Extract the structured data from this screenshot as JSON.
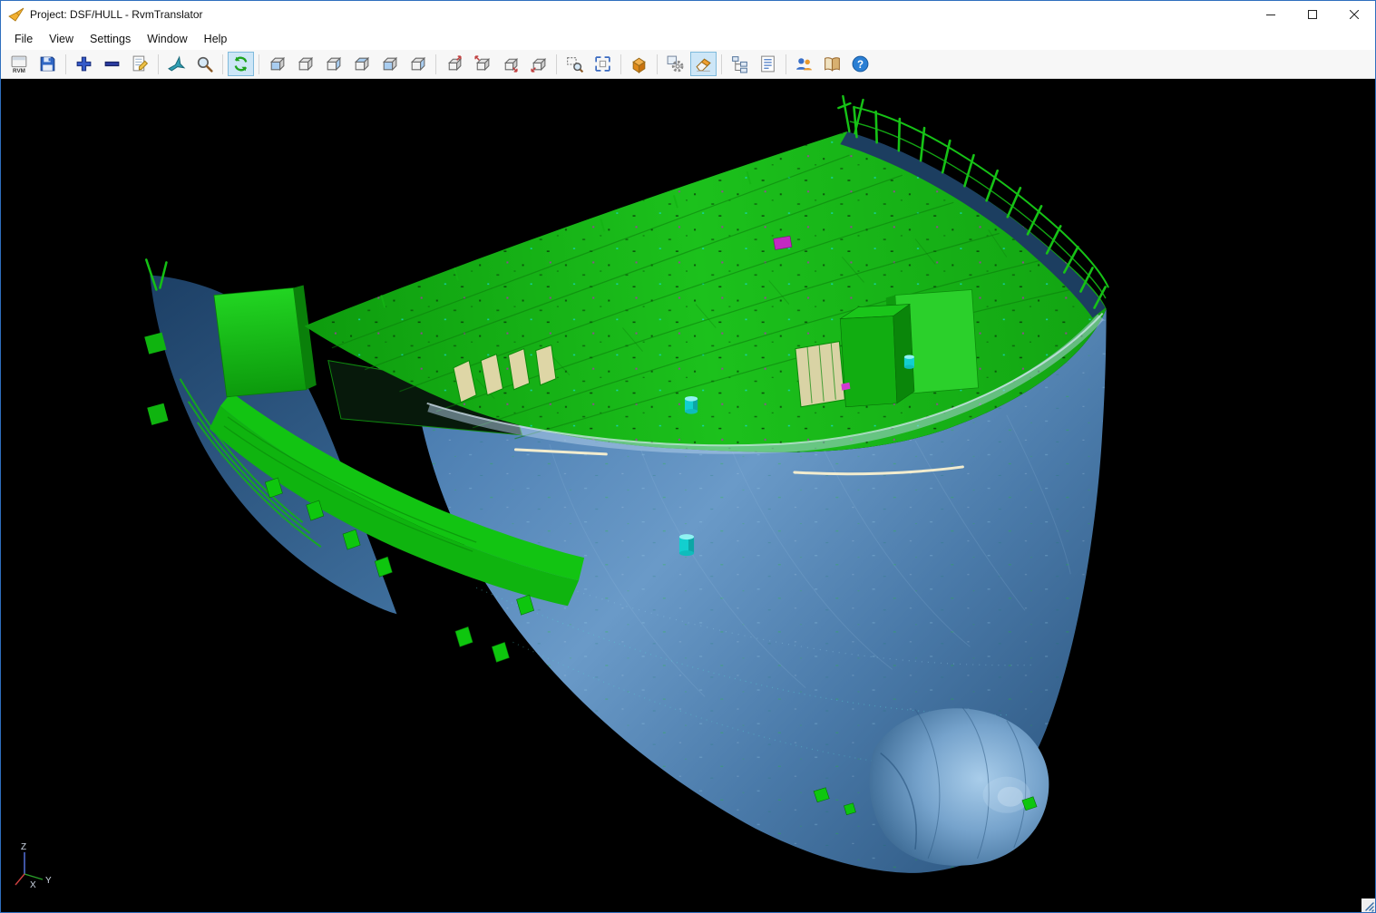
{
  "window": {
    "title": "Project: DSF/HULL - RvmTranslator",
    "controls": [
      {
        "name": "minimize",
        "icon": "minimize-icon"
      },
      {
        "name": "maximize",
        "icon": "maximize-icon"
      },
      {
        "name": "close",
        "icon": "close-icon"
      }
    ]
  },
  "menu": {
    "items": [
      {
        "label": "File"
      },
      {
        "label": "View"
      },
      {
        "label": "Settings"
      },
      {
        "label": "Window"
      },
      {
        "label": "Help"
      }
    ]
  },
  "toolbar": {
    "groups": [
      {
        "buttons": [
          {
            "name": "open-rvm",
            "icon": "rvm-file-icon",
            "selected": false
          },
          {
            "name": "save",
            "icon": "save-icon",
            "selected": false
          }
        ]
      },
      {
        "buttons": [
          {
            "name": "zoom-in",
            "icon": "plus-icon",
            "selected": false
          },
          {
            "name": "zoom-out",
            "icon": "minus-icon",
            "selected": false
          },
          {
            "name": "export-report",
            "icon": "document-edit-icon",
            "selected": false
          }
        ]
      },
      {
        "buttons": [
          {
            "name": "fly-through",
            "icon": "jet-icon",
            "selected": false
          },
          {
            "name": "zoom-view",
            "icon": "magnifier-icon",
            "selected": false
          }
        ]
      },
      {
        "buttons": [
          {
            "name": "refresh-view",
            "icon": "refresh-icon",
            "selected": true
          }
        ]
      },
      {
        "buttons": [
          {
            "name": "view-front",
            "icon": "cube-front-icon",
            "selected": false
          },
          {
            "name": "view-back",
            "icon": "cube-back-icon",
            "selected": false
          },
          {
            "name": "view-left",
            "icon": "cube-left-icon",
            "selected": false
          },
          {
            "name": "view-right",
            "icon": "cube-right-icon",
            "selected": false
          },
          {
            "name": "view-top",
            "icon": "cube-top-icon",
            "selected": false
          },
          {
            "name": "view-bottom",
            "icon": "cube-bottom-icon",
            "selected": false
          }
        ]
      },
      {
        "buttons": [
          {
            "name": "view-iso-1",
            "icon": "cube-iso-ne-icon",
            "selected": false
          },
          {
            "name": "view-iso-2",
            "icon": "cube-iso-nw-icon",
            "selected": false
          },
          {
            "name": "view-iso-3",
            "icon": "cube-iso-se-icon",
            "selected": false
          },
          {
            "name": "view-iso-4",
            "icon": "cube-iso-sw-icon",
            "selected": false
          }
        ]
      },
      {
        "buttons": [
          {
            "name": "zoom-window",
            "icon": "zoom-area-icon",
            "selected": false
          },
          {
            "name": "zoom-extents",
            "icon": "expand-icon",
            "selected": false
          }
        ]
      },
      {
        "buttons": [
          {
            "name": "show-box",
            "icon": "orange-box-icon",
            "selected": false
          }
        ]
      },
      {
        "buttons": [
          {
            "name": "settings",
            "icon": "gear-icon",
            "selected": false
          },
          {
            "name": "clear-highlight",
            "icon": "eraser-icon",
            "selected": true
          }
        ]
      },
      {
        "buttons": [
          {
            "name": "model-tree",
            "icon": "tree-icon",
            "selected": false
          },
          {
            "name": "report-view",
            "icon": "report-icon",
            "selected": false
          }
        ]
      },
      {
        "buttons": [
          {
            "name": "about-users",
            "icon": "users-icon",
            "selected": false
          },
          {
            "name": "manual",
            "icon": "book-icon",
            "selected": false
          },
          {
            "name": "help",
            "icon": "help-icon",
            "selected": false
          }
        ]
      }
    ]
  },
  "viewport": {
    "model": "ship-hull-bow-block-3d",
    "background": "#000000",
    "colors": {
      "hull_blue": "#4a7aa9",
      "deck_green": "#1cc11c",
      "structure_green": "#0ec60e",
      "highlight_cyan": "#12cfcf",
      "accent_magenta": "#c22ac2"
    },
    "axis": {
      "x": "X",
      "y": "Y",
      "z": "Z"
    }
  },
  "ui_colors": {
    "selected_button_bg": "#cde6f7",
    "selected_button_border": "#7fbadc",
    "window_border": "#2f6fbe"
  }
}
